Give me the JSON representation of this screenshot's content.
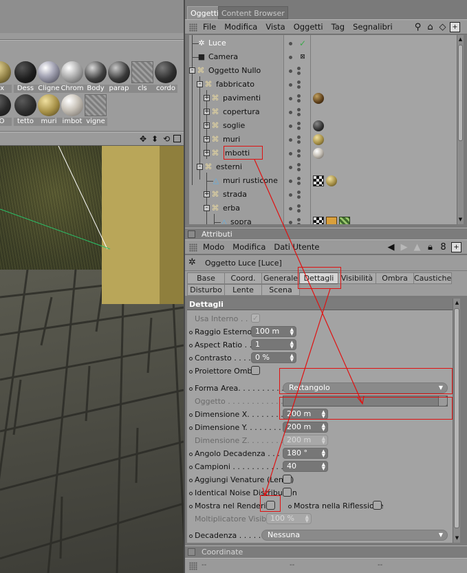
{
  "materials": {
    "row1": [
      "ux",
      "Dess",
      "Cligne",
      "Chrom",
      "Body",
      "parap",
      "cls",
      "cordo"
    ],
    "row2": [
      "LO",
      "tetto",
      "muri",
      "imbot",
      "vigne"
    ]
  },
  "viewport": {
    "icons": [
      "move-icon",
      "dolly-icon",
      "rotate-icon",
      "maximize-icon"
    ]
  },
  "objects_manager": {
    "tabs": [
      "Oggetti",
      "Content Browser"
    ],
    "menu": [
      "File",
      "Modifica",
      "Vista",
      "Oggetti",
      "Tag",
      "Segnalibri"
    ],
    "tree": [
      {
        "name": "Luce",
        "type": "light",
        "indent": 0,
        "selected": true,
        "tags": []
      },
      {
        "name": "Camera",
        "type": "camera",
        "indent": 0,
        "tags": []
      },
      {
        "name": "Oggetto Nullo",
        "type": "null",
        "indent": 0,
        "expander": "-",
        "tags": []
      },
      {
        "name": "fabbricato",
        "type": "null",
        "indent": 1,
        "expander": "-",
        "tags": []
      },
      {
        "name": "pavimenti",
        "type": "null",
        "indent": 2,
        "expander": "+",
        "tags": [
          "ball-brown"
        ]
      },
      {
        "name": "copertura",
        "type": "null",
        "indent": 2,
        "expander": "+",
        "tags": []
      },
      {
        "name": "soglie",
        "type": "null",
        "indent": 2,
        "expander": "+",
        "tags": [
          "ball-dark"
        ]
      },
      {
        "name": "muri",
        "type": "null",
        "indent": 2,
        "expander": "+",
        "tags": [
          "ball-tan"
        ]
      },
      {
        "name": "imbotti",
        "type": "null",
        "indent": 2,
        "expander": "+",
        "tags": [
          "ball-light"
        ]
      },
      {
        "name": "esterni",
        "type": "null",
        "indent": 1,
        "expander": "-",
        "tags": []
      },
      {
        "name": "muri rusticone",
        "type": "polygon",
        "indent": 2,
        "tags": [
          "checker",
          "ball-tan"
        ]
      },
      {
        "name": "strada",
        "type": "null",
        "indent": 2,
        "expander": "+",
        "tags": []
      },
      {
        "name": "erba",
        "type": "null",
        "indent": 2,
        "expander": "-",
        "tags": []
      },
      {
        "name": "sopra",
        "type": "polygon",
        "indent": 3,
        "tags": [
          "checker",
          "clap",
          "green"
        ]
      }
    ]
  },
  "attributes": {
    "title": "Attributi",
    "menu": [
      "Modo",
      "Modifica",
      "Dati Utente"
    ],
    "object_title": "Oggetto Luce [Luce]",
    "tabs_row1": [
      "Base",
      "Coord.",
      "Generale",
      "Dettagli",
      "Visibilità",
      "Ombra",
      "Caustiche"
    ],
    "tabs_row2": [
      "Disturbo",
      "Lente",
      "Scena"
    ],
    "active_tab": "Dettagli",
    "section": "Dettagli",
    "params": {
      "usa_interno": {
        "label": "Usa Interno . . . .",
        "checked": true
      },
      "raggio_esterno": {
        "label": "Raggio Esterno",
        "value": "100 m"
      },
      "aspect_ratio": {
        "label": "Aspect Ratio . .",
        "value": "1"
      },
      "contrasto": {
        "label": "Contrasto . . . . .",
        "value": "0 %"
      },
      "proiettore_ombre": {
        "label": "Proiettore Ombre"
      },
      "forma_area": {
        "label": "Forma Area. . . . . . . . . . .",
        "value": "Rettangolo"
      },
      "oggetto": {
        "label": "Oggetto . . . . . . . . . . . . . ."
      },
      "dimensione_x": {
        "label": "Dimensione X. . . . . . . . . .",
        "value": "200 m"
      },
      "dimensione_y": {
        "label": "Dimensione Y. . . . . . . . . .",
        "value": "200 m"
      },
      "dimensione_z": {
        "label": "Dimensione Z. . . . . . . . . .",
        "value": "200 m"
      },
      "angolo_decadenza": {
        "label": "Angolo Decadenza . . . . .",
        "value": "180 °"
      },
      "campioni": {
        "label": "Campioni . . . . . . . . . . . . .",
        "value": "40"
      },
      "aggiungi_venature": {
        "label": "Aggiungi Venature (Lento)"
      },
      "identical_noise": {
        "label": "Identical Noise Distribution"
      },
      "mostra_rendering": {
        "label": "Mostra nel Rendering"
      },
      "mostra_riflessione": {
        "label": "Mostra nella Riflessione"
      },
      "moltiplicatore": {
        "label": "Moltiplicatore Visibilità",
        "value": "100 %"
      },
      "decadenza": {
        "label": "Decadenza . . . . .",
        "value": "Nessuna"
      }
    }
  },
  "coordinates_bar": {
    "title": "Coordinate",
    "placeholders": [
      "--",
      "--",
      "--"
    ]
  },
  "colors": {
    "annotation": "#e01010",
    "panel": "#9c9c9c",
    "wall": "#b9a659"
  }
}
